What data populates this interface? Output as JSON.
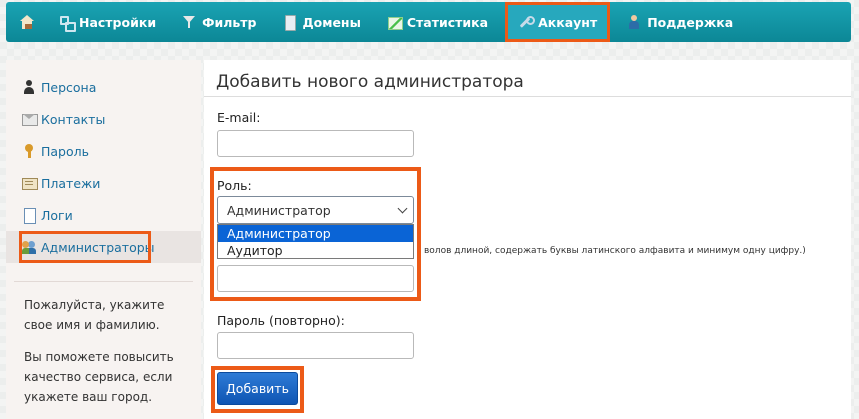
{
  "nav": {
    "home_icon": "home-icon",
    "items": [
      {
        "label": "Настройки",
        "icon": "settings-icon"
      },
      {
        "label": "Фильтр",
        "icon": "filter-icon"
      },
      {
        "label": "Домены",
        "icon": "domains-icon"
      },
      {
        "label": "Статистика",
        "icon": "stats-icon"
      },
      {
        "label": "Аккаунт",
        "icon": "account-icon",
        "active": true
      },
      {
        "label": "Поддержка",
        "icon": "support-icon"
      }
    ]
  },
  "sidebar": {
    "items": [
      {
        "label": "Персона",
        "icon": "person-icon"
      },
      {
        "label": "Контакты",
        "icon": "contacts-icon"
      },
      {
        "label": "Пароль",
        "icon": "password-icon"
      },
      {
        "label": "Платежи",
        "icon": "payments-icon"
      },
      {
        "label": "Логи",
        "icon": "logs-icon"
      },
      {
        "label": "Администраторы",
        "icon": "admins-icon",
        "active": true
      }
    ],
    "note1": "Пожалуйста, укажите свое имя и фамилию.",
    "note2": "Вы поможете повысить качество сервиса, если укажете ваш город."
  },
  "form": {
    "title": "Добавить нового администратора",
    "email_label": "E-mail:",
    "email_value": "",
    "role_label": "Роль:",
    "role_selected": "Администратор",
    "role_options": [
      "Администратор",
      "Аудитор"
    ],
    "password_hint": "волов длиной, содержать буквы латинского алфавита и минимум одну цифру.)",
    "password_value": "",
    "password_repeat_label": "Пароль (повторно):",
    "password_repeat_value": "",
    "submit_label": "Добавить"
  },
  "colors": {
    "nav_bg": "#0c8796",
    "highlight": "#ec5a17",
    "link": "#1a6e9e",
    "button": "#1565c0"
  }
}
